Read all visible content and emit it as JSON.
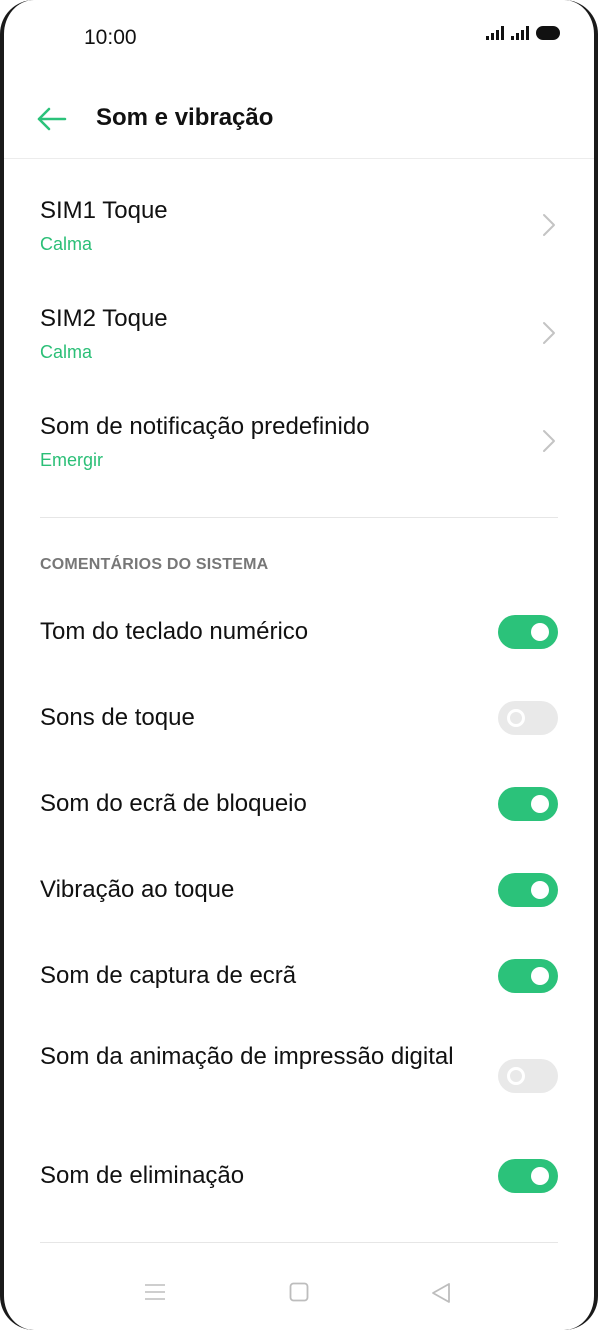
{
  "status_bar": {
    "time": "10:00"
  },
  "header": {
    "title": "Som e vibração",
    "back_icon": "arrow-left-icon"
  },
  "ringtones": [
    {
      "title": "SIM1 Toque",
      "value": "Calma"
    },
    {
      "title": "SIM2 Toque",
      "value": "Calma"
    },
    {
      "title": "Som de notificação predefinido",
      "value": "Emergir"
    }
  ],
  "system_feedback": {
    "header": "COMENTÁRIOS DO SISTEMA",
    "items": [
      {
        "label": "Tom do teclado numérico",
        "enabled": true
      },
      {
        "label": "Sons de toque",
        "enabled": false
      },
      {
        "label": "Som do ecrã de bloqueio",
        "enabled": true
      },
      {
        "label": "Vibração ao toque",
        "enabled": true
      },
      {
        "label": "Som de captura de ecrã",
        "enabled": true
      },
      {
        "label": "Som da animação de impressão digital",
        "enabled": false
      },
      {
        "label": "Som de eliminação",
        "enabled": true
      }
    ]
  },
  "colors": {
    "accent": "#2bc27a",
    "subtitle": "#2bbf77",
    "toggle_off": "#e9e9e9"
  },
  "nav_bar": {
    "icons": [
      "menu-icon",
      "home-icon",
      "back-triangle-icon"
    ]
  }
}
